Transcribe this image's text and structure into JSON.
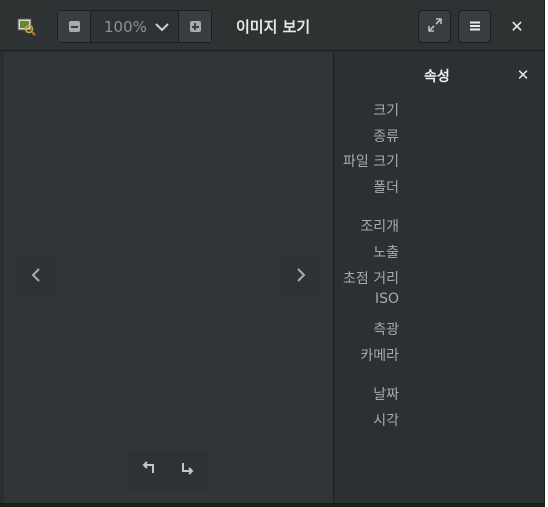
{
  "header": {
    "title": "이미지 보기",
    "zoom_value": "100%"
  },
  "icons": {
    "app": "image-viewer-icon",
    "zoom_out": "zoom-out-icon",
    "zoom_in": "zoom-in-icon",
    "dropdown": "chevron-down-icon",
    "fullscreen": "fullscreen-icon",
    "menu": "hamburger-menu-icon",
    "close": "close-icon",
    "prev": "chevron-left-icon",
    "next": "chevron-right-icon",
    "rotate_left": "rotate-left-icon",
    "rotate_right": "rotate-right-icon"
  },
  "properties": {
    "title": "속성",
    "labels": [
      "크기",
      "종류",
      "파일 크기",
      "폴더",
      "조리개",
      "노출",
      "초점 거리",
      "ISO",
      "측광",
      "카메라",
      "날짜",
      "시각"
    ]
  },
  "colors": {
    "window_bg": "#2b2e30",
    "viewer_bg": "#323537",
    "text_primary": "#e6e8e8",
    "text_secondary": "#a6aaac"
  }
}
